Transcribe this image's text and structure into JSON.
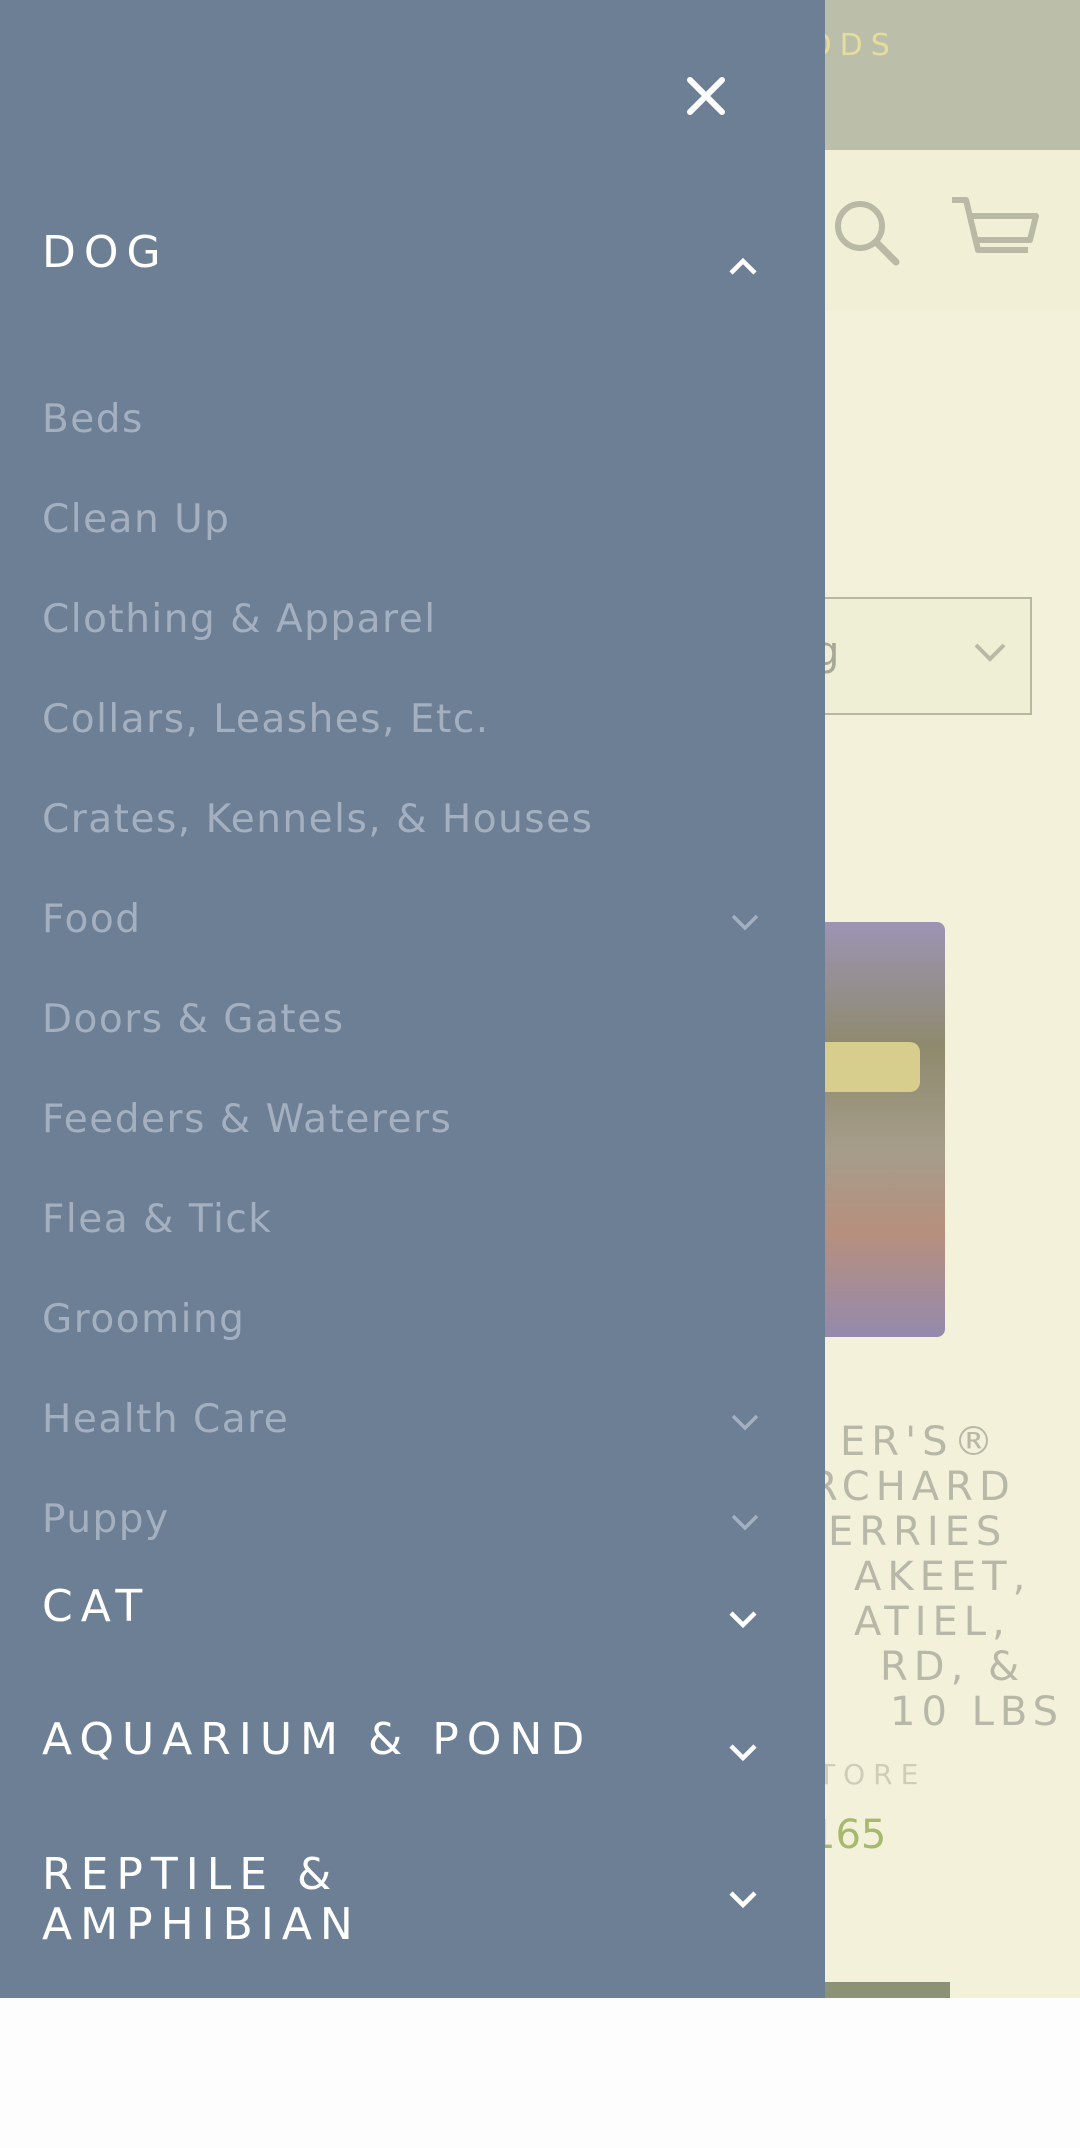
{
  "background_page": {
    "announcement_text": "ODS",
    "sort_value": "g",
    "product": {
      "title_lines": [
        "ER'S®",
        "RCHARD",
        "ERRIES",
        "AKEET,",
        "ATIEL,",
        "RD, &",
        "10 LBS"
      ],
      "vendor": "TORE",
      "price": "165"
    },
    "icons": [
      "search-icon",
      "cart-icon",
      "chevron-down-icon"
    ]
  },
  "drawer": {
    "close_icon": "close-icon",
    "categories": [
      {
        "label": "DOG",
        "expanded": true,
        "items": [
          {
            "label": "Beds",
            "has_children": false
          },
          {
            "label": "Clean Up",
            "has_children": false
          },
          {
            "label": "Clothing & Apparel",
            "has_children": false
          },
          {
            "label": "Collars, Leashes, Etc.",
            "has_children": false
          },
          {
            "label": "Crates, Kennels, & Houses",
            "has_children": false
          },
          {
            "label": "Food",
            "has_children": true
          },
          {
            "label": "Doors & Gates",
            "has_children": false
          },
          {
            "label": "Feeders & Waterers",
            "has_children": false
          },
          {
            "label": "Flea & Tick",
            "has_children": false
          },
          {
            "label": "Grooming",
            "has_children": false
          },
          {
            "label": "Health Care",
            "has_children": true
          },
          {
            "label": "Puppy",
            "has_children": true
          }
        ]
      },
      {
        "label": "CAT",
        "expanded": false
      },
      {
        "label": "AQUARIUM & POND",
        "expanded": false
      },
      {
        "label": "REPTILE & AMPHIBIAN",
        "label_lines": [
          "REPTILE &",
          "AMPHIBIAN"
        ],
        "expanded": false
      }
    ]
  },
  "colors": {
    "drawer_bg": "#6d7f95",
    "heading": "#ffffff",
    "subitem": "#a4b0bf",
    "page_bg": "#f3f1da",
    "announcement_bg": "#bbbfa9",
    "price": "#a6b96e"
  }
}
